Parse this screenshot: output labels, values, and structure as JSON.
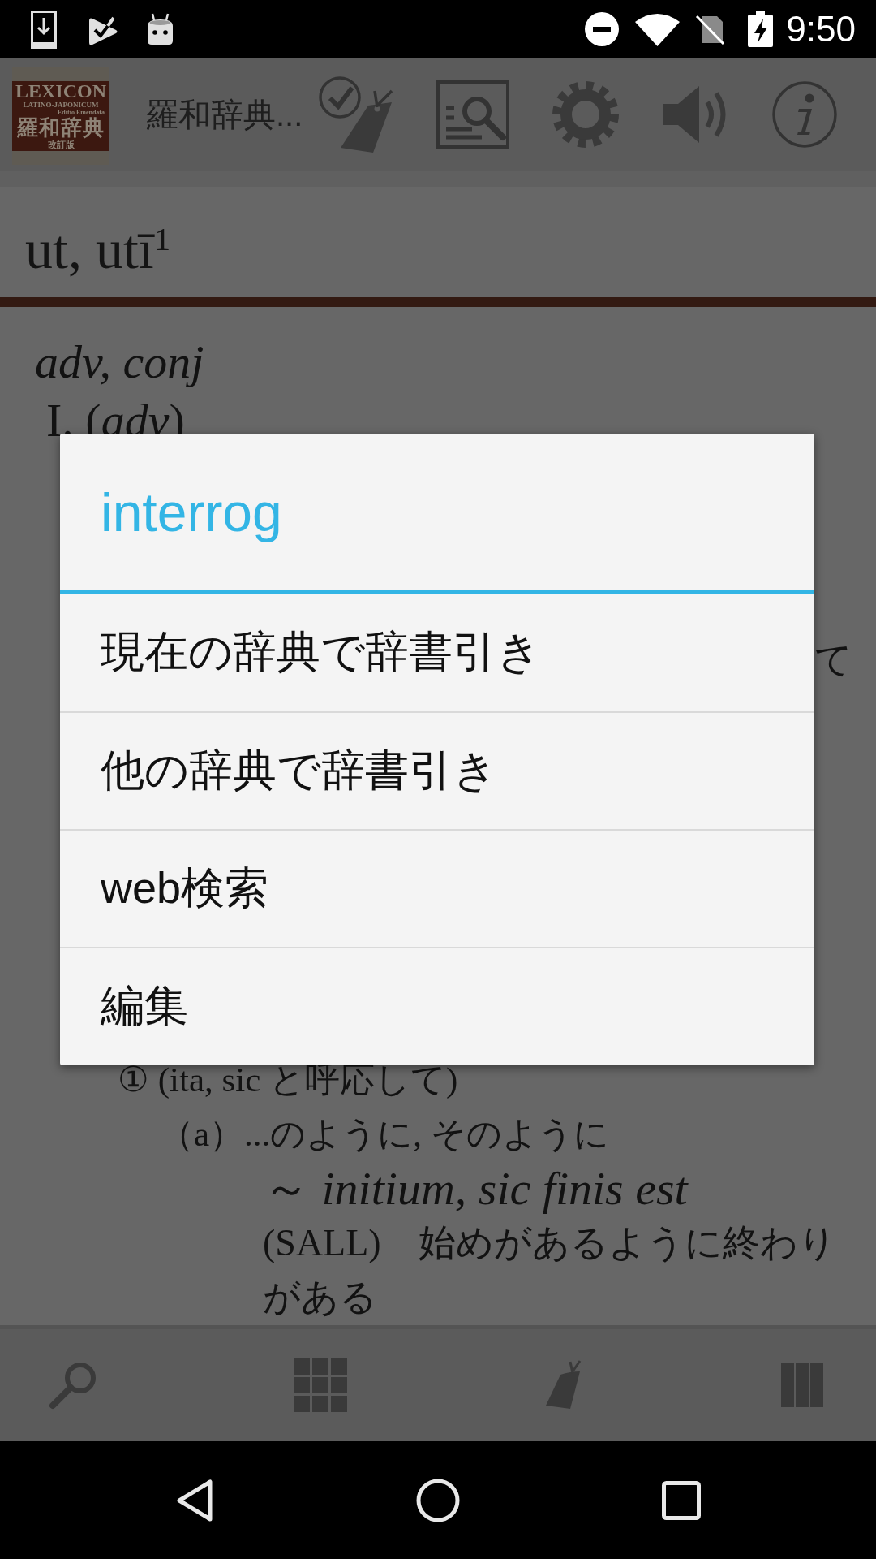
{
  "status_bar": {
    "time": "9:50"
  },
  "toolbar": {
    "logo": {
      "latin_title": "LEXICON",
      "latin_subtitle": "LATINO-JAPONICUM",
      "edition": "Editio Emendata",
      "japanese_title": "羅和辞典",
      "revised": "改訂版"
    },
    "title": "羅和辞典..."
  },
  "headword": "ut, utī$^{1}$",
  "entry": {
    "lines_above": [
      {
        "kind": "pos",
        "text": "adv, conj",
        "children": [
          {
            "kind": "part",
            "text": "I. (*adv*)"
          }
        ]
      }
    ],
    "covered_fragment": "て",
    "lines_below": [
      {
        "kind": "sense",
        "text": "① (ita, sic と呼応して)",
        "children": [
          {
            "kind": "sense",
            "text": "（a）...のように, そのように",
            "children": [
              {
                "kind": "example",
                "text": "～ *initium, sic finis est*"
              },
              {
                "kind": "translation",
                "text": "(SALL)　始めがあるように終わりがある"
              }
            ]
          }
        ]
      }
    ]
  },
  "dialog": {
    "title": "interrog",
    "items": [
      {
        "label": "現在の辞典で辞書引き"
      },
      {
        "label": "他の辞典で辞書引き"
      },
      {
        "label": "web検索"
      },
      {
        "label": "編集"
      }
    ]
  }
}
